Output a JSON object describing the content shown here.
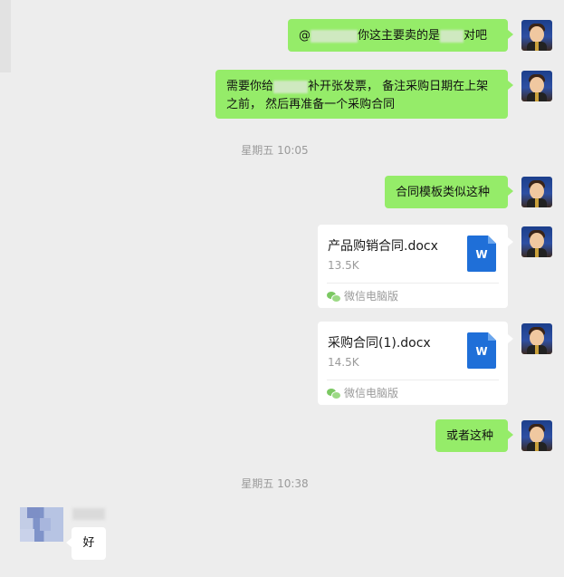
{
  "messages": [
    {
      "type": "text",
      "from": "me",
      "segments": [
        "@",
        "你这主要卖的是",
        "对吧"
      ]
    },
    {
      "type": "text",
      "from": "me",
      "segments": [
        "需要你给",
        "补开张发票， 备注采购日期在上架之前， 然后再准备一个采购合同"
      ]
    },
    {
      "type": "timestamp",
      "text": "星期五 10:05"
    },
    {
      "type": "text",
      "from": "me",
      "text": "合同模板类似这种"
    },
    {
      "type": "file",
      "from": "me",
      "name": "产品购销合同.docx",
      "size": "13.5K",
      "source": "微信电脑版",
      "icon": "word-doc-icon"
    },
    {
      "type": "file",
      "from": "me",
      "name": "采购合同(1).docx",
      "size": "14.5K",
      "source": "微信电脑版",
      "icon": "word-doc-icon"
    },
    {
      "type": "text",
      "from": "me",
      "text": "或者这种"
    },
    {
      "type": "timestamp",
      "text": "星期五 10:38"
    },
    {
      "type": "text",
      "from": "other",
      "text": "好"
    }
  ],
  "file_icon_letter": "W",
  "colors": {
    "my_bubble": "#95ec69",
    "background": "#ededed",
    "word_blue": "#1f6fd8"
  }
}
